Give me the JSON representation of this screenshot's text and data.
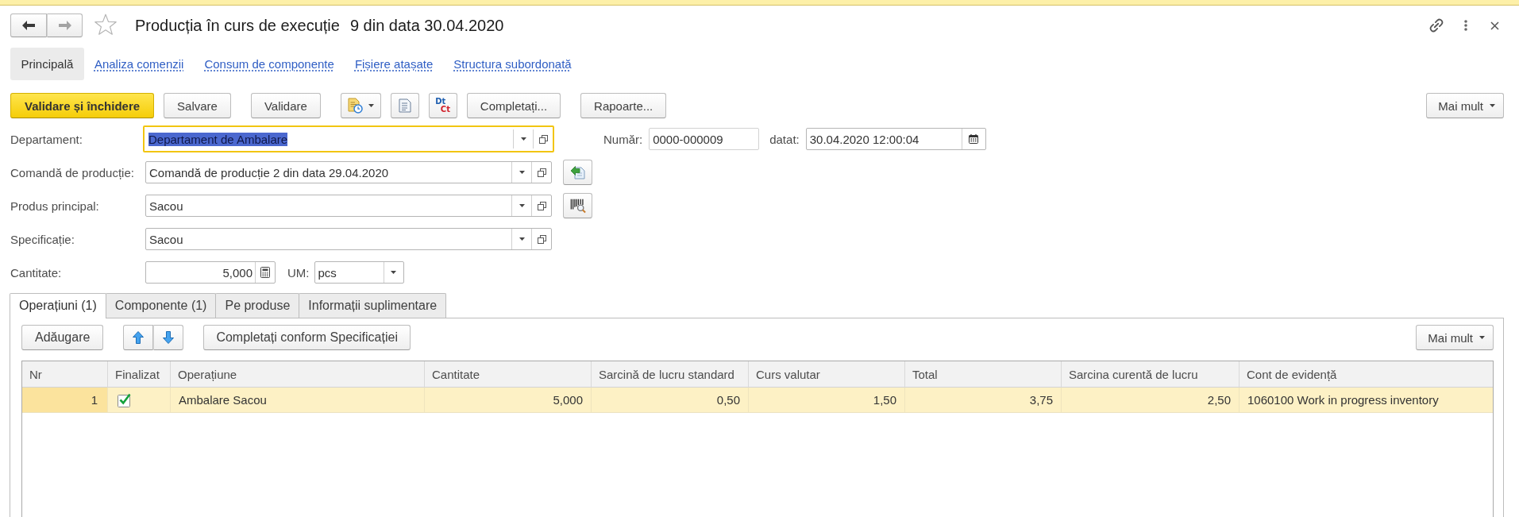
{
  "window": {
    "title": "Producția în curs de execuție",
    "subtitle": "9 din data 30.04.2020",
    "favorite": false,
    "back_enabled": true,
    "forward_enabled": false
  },
  "nav_tabs": [
    {
      "label": "Principală",
      "selected": true
    },
    {
      "label": "Analiza comenzii",
      "selected": false
    },
    {
      "label": "Consum de componente",
      "selected": false
    },
    {
      "label": "Fișiere atașate",
      "selected": false
    },
    {
      "label": "Structura subordonată",
      "selected": false
    }
  ],
  "toolbar": [
    {
      "kind": "primary",
      "label": "Validare și închidere"
    },
    {
      "kind": "button",
      "label": "Salvare"
    },
    {
      "kind": "button",
      "label": "Validare"
    },
    {
      "kind": "report-menu"
    },
    {
      "kind": "document"
    },
    {
      "kind": "ledger",
      "debit": "Dt",
      "credit": "Ct"
    },
    {
      "kind": "button",
      "label": "Completați..."
    },
    {
      "kind": "button",
      "label": "Rapoarte..."
    },
    {
      "kind": "more",
      "label": "Mai mult"
    }
  ],
  "fields": [
    {
      "kind": "select",
      "label": "Departament:",
      "value": "Departament de Ambalare",
      "focused": true,
      "extras": [
        {
          "kind": "text",
          "label": "Număr:",
          "value": "0000-000009"
        },
        {
          "kind": "date",
          "label": "datat:",
          "value": "30.04.2020 12:00:04"
        }
      ]
    },
    {
      "kind": "select",
      "label": "Comandă de producție:",
      "value": "Comandă de producție 2 din data 29.04.2020",
      "focused": false,
      "side_button": {
        "kind": "fill"
      }
    },
    {
      "kind": "select",
      "label": "Produs principal:",
      "value": "Sacou",
      "focused": false,
      "side_button": {
        "kind": "barcode"
      }
    },
    {
      "kind": "select",
      "label": "Specificație:",
      "value": "Sacou",
      "focused": false
    },
    {
      "kind": "number",
      "label": "Cantitate:",
      "value": "5,000",
      "focused": false,
      "unit": {
        "label": "UM:",
        "value": "pcs"
      }
    }
  ],
  "tabs": [
    {
      "label": "Operațiuni (1)",
      "selected": true
    },
    {
      "label": "Componente (1)",
      "selected": false
    },
    {
      "label": "Pe produse",
      "selected": false
    },
    {
      "label": "Informații suplimentare",
      "selected": false
    }
  ],
  "table_toolbar": {
    "add": "Adăugare",
    "fill": "Completați conform Specificației",
    "more": "Mai mult"
  },
  "table": {
    "columns": [
      {
        "label": "Nr",
        "kind": "number"
      },
      {
        "label": "Finalizat",
        "kind": "check"
      },
      {
        "label": "Operațiune",
        "kind": "text"
      },
      {
        "label": "Cantitate",
        "kind": "number"
      },
      {
        "label": "Sarcină de lucru standard",
        "kind": "number"
      },
      {
        "label": "Curs valutar",
        "kind": "number"
      },
      {
        "label": "Total",
        "kind": "number"
      },
      {
        "label": "Sarcina curentă de lucru",
        "kind": "number"
      },
      {
        "label": "Cont de evidență",
        "kind": "text"
      }
    ],
    "rows": [
      {
        "selected": true,
        "cells": [
          {
            "text": "1"
          },
          {
            "checked": true
          },
          {
            "text": "Ambalare Sacou"
          },
          {
            "text": "5,000"
          },
          {
            "text": "0,50"
          },
          {
            "text": "1,50"
          },
          {
            "text": "3,75"
          },
          {
            "text": "2,50"
          },
          {
            "text": "1060100 Work in progress inventory"
          }
        ]
      }
    ]
  }
}
